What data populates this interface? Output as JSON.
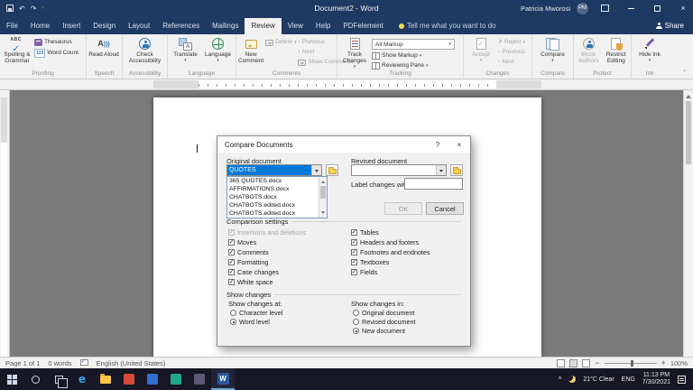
{
  "colors": {
    "titlebar_navy": "#1e3a62",
    "ribbon_gray": "#f1f1f1",
    "selection_blue": "#0078d7",
    "word_brand_blue": "#2b579a",
    "taskbar_dark": "#171725",
    "canvas_gray": "#7a7a7a"
  },
  "title_bar": {
    "title": "Document2 - Word",
    "user_name": "Patricia Mworosi",
    "user_initials": "PM"
  },
  "tab_row": {
    "tabs": [
      "File",
      "Home",
      "Insert",
      "Design",
      "Layout",
      "References",
      "Mailings",
      "Review",
      "View",
      "Help",
      "PDFelement"
    ],
    "active_tab": "Review",
    "tell_me": "Tell me what you want to do",
    "share_label": "Share"
  },
  "ribbon": {
    "proofing": {
      "title": "Proofing",
      "spelling_grammar": "Spelling & Grammar",
      "thesaurus": "Thesaurus",
      "word_count": "Word Count"
    },
    "speech": {
      "title": "Speech",
      "read_aloud": "Read Aloud"
    },
    "accessibility": {
      "title": "Accessibility",
      "check_accessibility": "Check Accessibility"
    },
    "language": {
      "title": "Language",
      "translate": "Translate",
      "language": "Language"
    },
    "comments": {
      "title": "Comments",
      "new_comment": "New Comment",
      "delete": "Delete",
      "previous": "Previous",
      "next": "Next",
      "show_comments": "Show Comments"
    },
    "tracking": {
      "title": "Tracking",
      "track_changes": "Track Changes",
      "display_for_review_value": "All Markup",
      "show_markup": "Show Markup",
      "reviewing_pane": "Reviewing Pane"
    },
    "changes": {
      "title": "Changes",
      "accept": "Accept",
      "reject": "Reject",
      "previous": "Previous",
      "next": "Next"
    },
    "compare": {
      "title": "Compare",
      "compare": "Compare"
    },
    "protect": {
      "title": "Protect",
      "block_authors": "Block Authors",
      "restrict_editing": "Restrict Editing"
    },
    "ink": {
      "title": "Ink",
      "hide_ink": "Hide Ink"
    }
  },
  "dialog": {
    "title": "Compare Documents",
    "original_document_label": "Original document",
    "original_document_value": "QUOTES",
    "revised_document_label": "Revised document",
    "revised_document_value": "",
    "label_changes_with": "Label changes with",
    "label_changes_value": "",
    "dropdown_items": [
      "365 QUOTES.docx",
      "AFFIRMATIONS.docx",
      "CHATBOTS.docx",
      "CHATBOTS.edited.docx",
      "CHATBOTS.edited.docx"
    ],
    "ok_label": "OK",
    "cancel_label": "Cancel",
    "comparison_settings_label": "Comparison settings",
    "checkboxes_left": [
      {
        "label": "Insertions and deletions",
        "checked": true,
        "disabled": true
      },
      {
        "label": "Moves",
        "checked": true,
        "disabled": false
      },
      {
        "label": "Comments",
        "checked": true,
        "disabled": false
      },
      {
        "label": "Formatting",
        "checked": true,
        "disabled": false
      },
      {
        "label": "Case changes",
        "checked": true,
        "disabled": false
      },
      {
        "label": "White space",
        "checked": true,
        "disabled": false
      }
    ],
    "checkboxes_right": [
      {
        "label": "Tables",
        "checked": true
      },
      {
        "label": "Headers and footers",
        "checked": true
      },
      {
        "label": "Footnotes and endnotes",
        "checked": true
      },
      {
        "label": "Textboxes",
        "checked": true
      },
      {
        "label": "Fields",
        "checked": true
      }
    ],
    "show_changes_label": "Show changes",
    "show_changes_at_label": "Show changes at:",
    "show_changes_at_options": [
      "Character level",
      "Word level"
    ],
    "show_changes_at_selected": "Word level",
    "show_changes_in_label": "Show changes in:",
    "show_changes_in_options": [
      "Original document",
      "Revised document",
      "New document"
    ],
    "show_changes_in_selected": "New document"
  },
  "status_bar": {
    "page_info": "Page 1 of 1",
    "word_count": "0 words",
    "language": "English (United States)",
    "zoom_level": "100%"
  },
  "taskbar": {
    "weather": "21°C Clear",
    "input_language": "ENG",
    "time": "11:13 PM",
    "date": "7/30/2021"
  }
}
